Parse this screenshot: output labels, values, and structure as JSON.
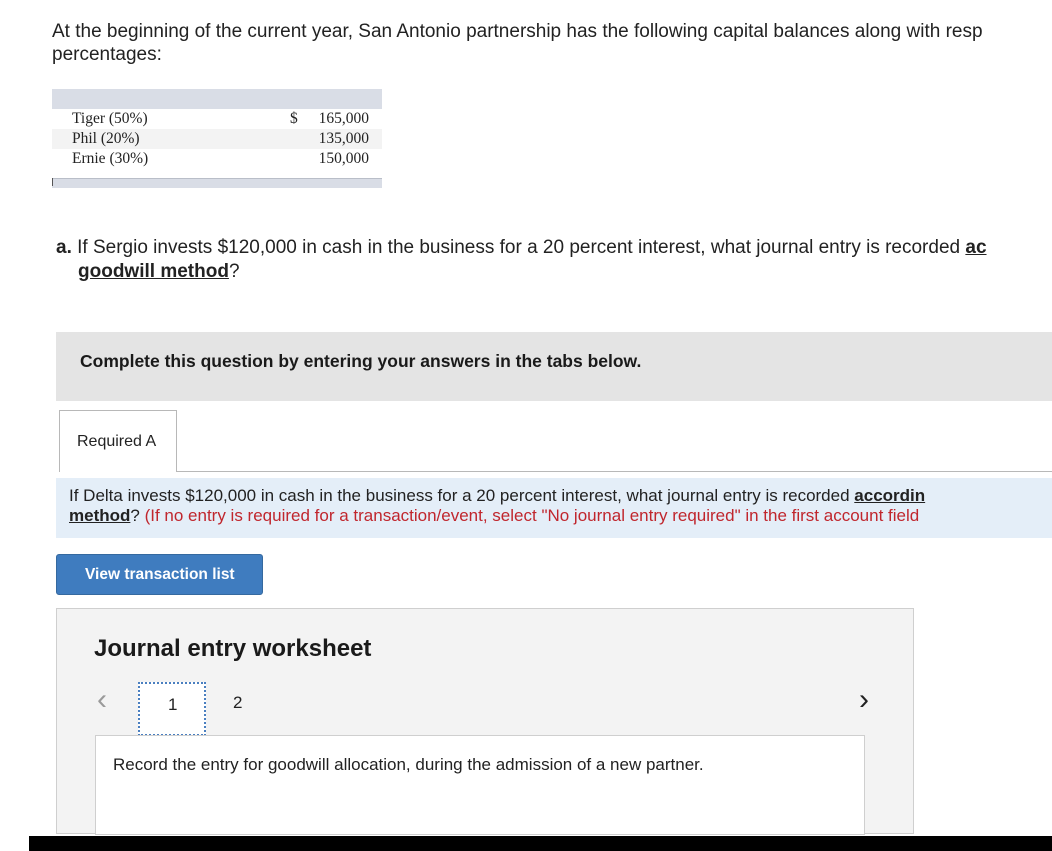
{
  "intro": {
    "line1": "At the beginning of the current year, San Antonio partnership has the following capital balances along with resp",
    "line2": "percentages:"
  },
  "capital_table": {
    "currency_symbol": "$",
    "rows": [
      {
        "name": "Tiger (50%)",
        "amount": "165,000"
      },
      {
        "name": "Phil (20%)",
        "amount": "135,000"
      },
      {
        "name": "Ernie (30%)",
        "amount": "150,000"
      }
    ]
  },
  "question": {
    "label": "a.",
    "text_part1": " If Sergio invests $120,000 in cash in the business for a 20 percent interest, what journal entry is recorded ",
    "link_part1": "ac",
    "link_part2": "goodwill method",
    "end": "?"
  },
  "complete_box": {
    "text": "Complete this question by entering your answers in the tabs below."
  },
  "tabs": [
    {
      "label": "Required A"
    }
  ],
  "instruction": {
    "part1": "If Delta invests $120,000 in cash in the business for a 20 percent interest, what journal entry is recorded ",
    "bold1": "accordin",
    "bold2": "method",
    "q": "?",
    "red": " (If no entry is required for a transaction/event, select \"No journal entry required\" in the first account field"
  },
  "buttons": {
    "view_transaction_list": "View transaction list"
  },
  "worksheet": {
    "title": "Journal entry worksheet",
    "pages": [
      "1",
      "2"
    ],
    "current_page": "1",
    "prev_icon": "chevron-left-icon",
    "next_icon": "chevron-right-icon",
    "record_text": "Record the entry for goodwill allocation, during the admission of a new partner."
  }
}
